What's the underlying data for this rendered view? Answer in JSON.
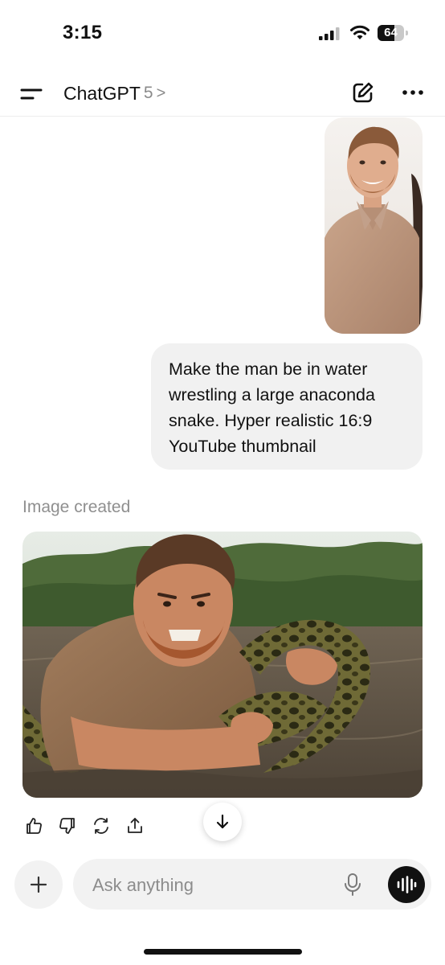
{
  "status": {
    "time": "3:15",
    "battery": "64",
    "battery_level": 0.64
  },
  "header": {
    "title": "ChatGPT",
    "model": "5",
    "chevron": ">"
  },
  "messages": {
    "user_text": "Make the man be in water wrestling a large anaconda snake. Hyper realistic 16:9 YouTube thumbnail",
    "assistant_label": "Image created"
  },
  "composer": {
    "placeholder": "Ask anything"
  },
  "icons": {
    "menu": "menu-icon",
    "edit": "edit-icon",
    "more": "ellipsis-icon",
    "like": "thumbs-up-icon",
    "dislike": "thumbs-down-icon",
    "regenerate": "regenerate-icon",
    "share": "share-icon",
    "scroll": "arrow-down-icon",
    "plus": "plus-icon",
    "mic": "microphone-icon",
    "voice": "voice-waveform-icon"
  },
  "colors": {
    "bubble": "#f1f1f1",
    "composer": "#f2f2f2",
    "muted_text": "#8f8f8f",
    "accent_dark": "#111111"
  }
}
